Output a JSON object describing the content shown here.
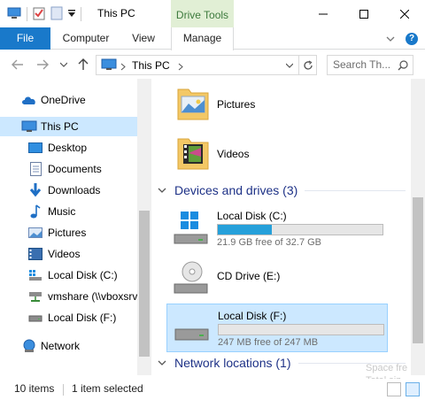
{
  "window": {
    "title": "This PC",
    "contextual_tab": "Drive Tools"
  },
  "ribbon": {
    "tabs": [
      {
        "label": "File"
      },
      {
        "label": "Computer"
      },
      {
        "label": "View"
      },
      {
        "label": "Manage"
      }
    ]
  },
  "address": {
    "path": "This PC",
    "search_placeholder": "Search Th..."
  },
  "nav": {
    "items": [
      {
        "label": "OneDrive",
        "icon": "onedrive-cloud-icon"
      },
      {
        "label": "This PC",
        "icon": "computer-icon",
        "selected": true
      },
      {
        "label": "Desktop",
        "icon": "desktop-icon"
      },
      {
        "label": "Documents",
        "icon": "documents-icon"
      },
      {
        "label": "Downloads",
        "icon": "downloads-icon"
      },
      {
        "label": "Music",
        "icon": "music-icon"
      },
      {
        "label": "Pictures",
        "icon": "pictures-icon"
      },
      {
        "label": "Videos",
        "icon": "videos-icon"
      },
      {
        "label": "Local Disk (C:)",
        "icon": "windows-drive-icon"
      },
      {
        "label": "vmshare (\\\\vboxsrv",
        "icon": "network-drive-icon"
      },
      {
        "label": "Local Disk (F:)",
        "icon": "drive-icon"
      },
      {
        "label": "Network",
        "icon": "network-icon"
      }
    ]
  },
  "content": {
    "folders": [
      {
        "label": "Pictures",
        "icon": "pictures-folder-icon"
      },
      {
        "label": "Videos",
        "icon": "videos-folder-icon"
      }
    ],
    "devices_header": "Devices and drives (3)",
    "drives": [
      {
        "name": "Local Disk (C:)",
        "free_text": "21.9 GB free of 32.7 GB",
        "used_fraction": 0.33,
        "has_bar": true,
        "selected": false
      },
      {
        "name": "CD Drive (E:)",
        "free_text": "",
        "has_bar": false,
        "selected": false
      },
      {
        "name": "Local Disk (F:)",
        "free_text": "247 MB free of 247 MB",
        "used_fraction": 0.0,
        "has_bar": true,
        "selected": true
      }
    ],
    "network_header": "Network locations (1)"
  },
  "status": {
    "item_count": "10 items",
    "selection": "1 item selected",
    "ghost_tooltip_line1": "Space fre",
    "ghost_tooltip_line2": "Total siz"
  },
  "colors": {
    "accent": "#1979ca",
    "selection": "#cce8ff",
    "group_header": "#1e3287",
    "drive_bar_fill": "#26a0da"
  }
}
